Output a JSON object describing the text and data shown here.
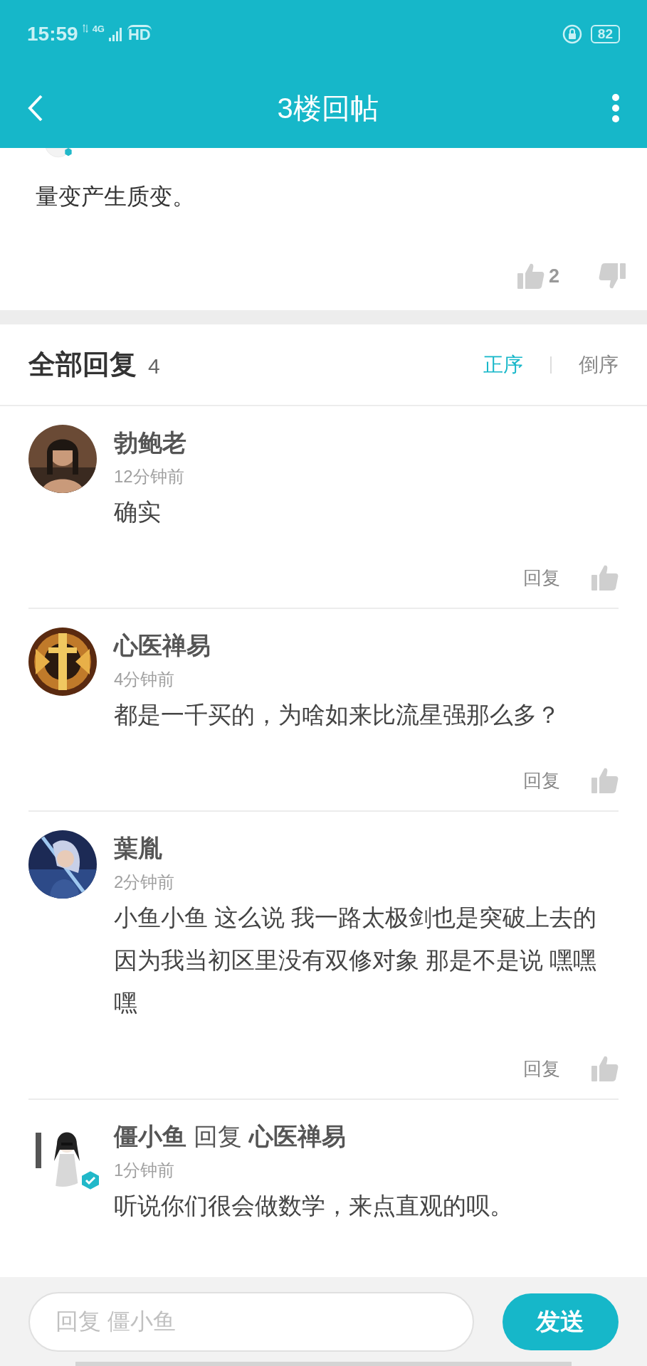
{
  "status_bar": {
    "time": "15:59",
    "network": "4G",
    "hd": "HD",
    "battery": "82"
  },
  "header": {
    "title": "3楼回帖"
  },
  "post": {
    "text": "量变产生质变。",
    "likes": "2"
  },
  "replies_header": {
    "title": "全部回复",
    "count": "4",
    "sort": [
      {
        "label": "正序",
        "selected": true
      },
      {
        "label": "倒序",
        "selected": false
      }
    ]
  },
  "comments": [
    {
      "author": "勃鲍老",
      "time": "12分钟前",
      "text": "确实",
      "reply_label": "回复",
      "verified": false
    },
    {
      "author": "心医禅易",
      "time": "4分钟前",
      "text": "都是一千买的，为啥如来比流星强那么多？",
      "reply_label": "回复",
      "verified": false
    },
    {
      "author": "葉胤",
      "time": "2分钟前",
      "text": "小鱼小鱼 这么说 我一路太极剑也是突破上去的因为我当初区里没有双修对象 那是不是说 嘿嘿嘿",
      "reply_label": "回复",
      "verified": false
    },
    {
      "author": "僵小鱼",
      "reply_word": "回复",
      "reply_to": "心医禅易",
      "time": "1分钟前",
      "text": "听说你们很会做数学，来点直观的呗。",
      "verified": true
    }
  ],
  "composer": {
    "placeholder": "回复 僵小鱼",
    "send": "发送"
  }
}
